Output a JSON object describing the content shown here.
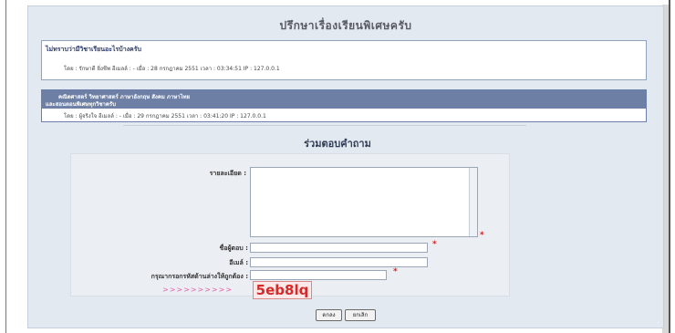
{
  "page_title": "ปรึกษาเรื่องเรียนพิเศษครับ",
  "post1": {
    "subject": "ไม่ทราบว่ามีวิชาเรียนอะไรบ้างครับ",
    "meta": "โดย : รักษาดี ยิ่งชีพ  อีเมลล์ : -  เมื่อ : 28 กรกฎาคม 2551  เวลา : 03:34:51   IP : 127.0.0.1"
  },
  "post2": {
    "line1": "คณิตศาสตร์ วิทยาศาสตร์ ภาษาอังกฤษ สังคม ภาษาไทย",
    "line2": "และสอนตอนพิเศษทุกวิชาครับ",
    "meta": "โดย : ผู้จริงใจ  อีเมลล์ : -  เมื่อ : 29 กรกฎาคม 2551  เวลา : 03:41:20   IP : 127.0.0.1"
  },
  "reply": {
    "title": "ร่วมตอบคำถาม",
    "details_label": "รายละเอียด :",
    "name_label": "ชื่อผู้ตอบ :",
    "email_label": "อีเมล์ :",
    "captcha_label": "กรุณากรอกรหัสด้านล่างให้ถูกต้อง :",
    "required_mark": "*",
    "arrows": ">>>>>>>>>>",
    "captcha_code": "5eb8lq",
    "submit_label": "ตกลง",
    "cancel_label": "ยกเลิก"
  }
}
